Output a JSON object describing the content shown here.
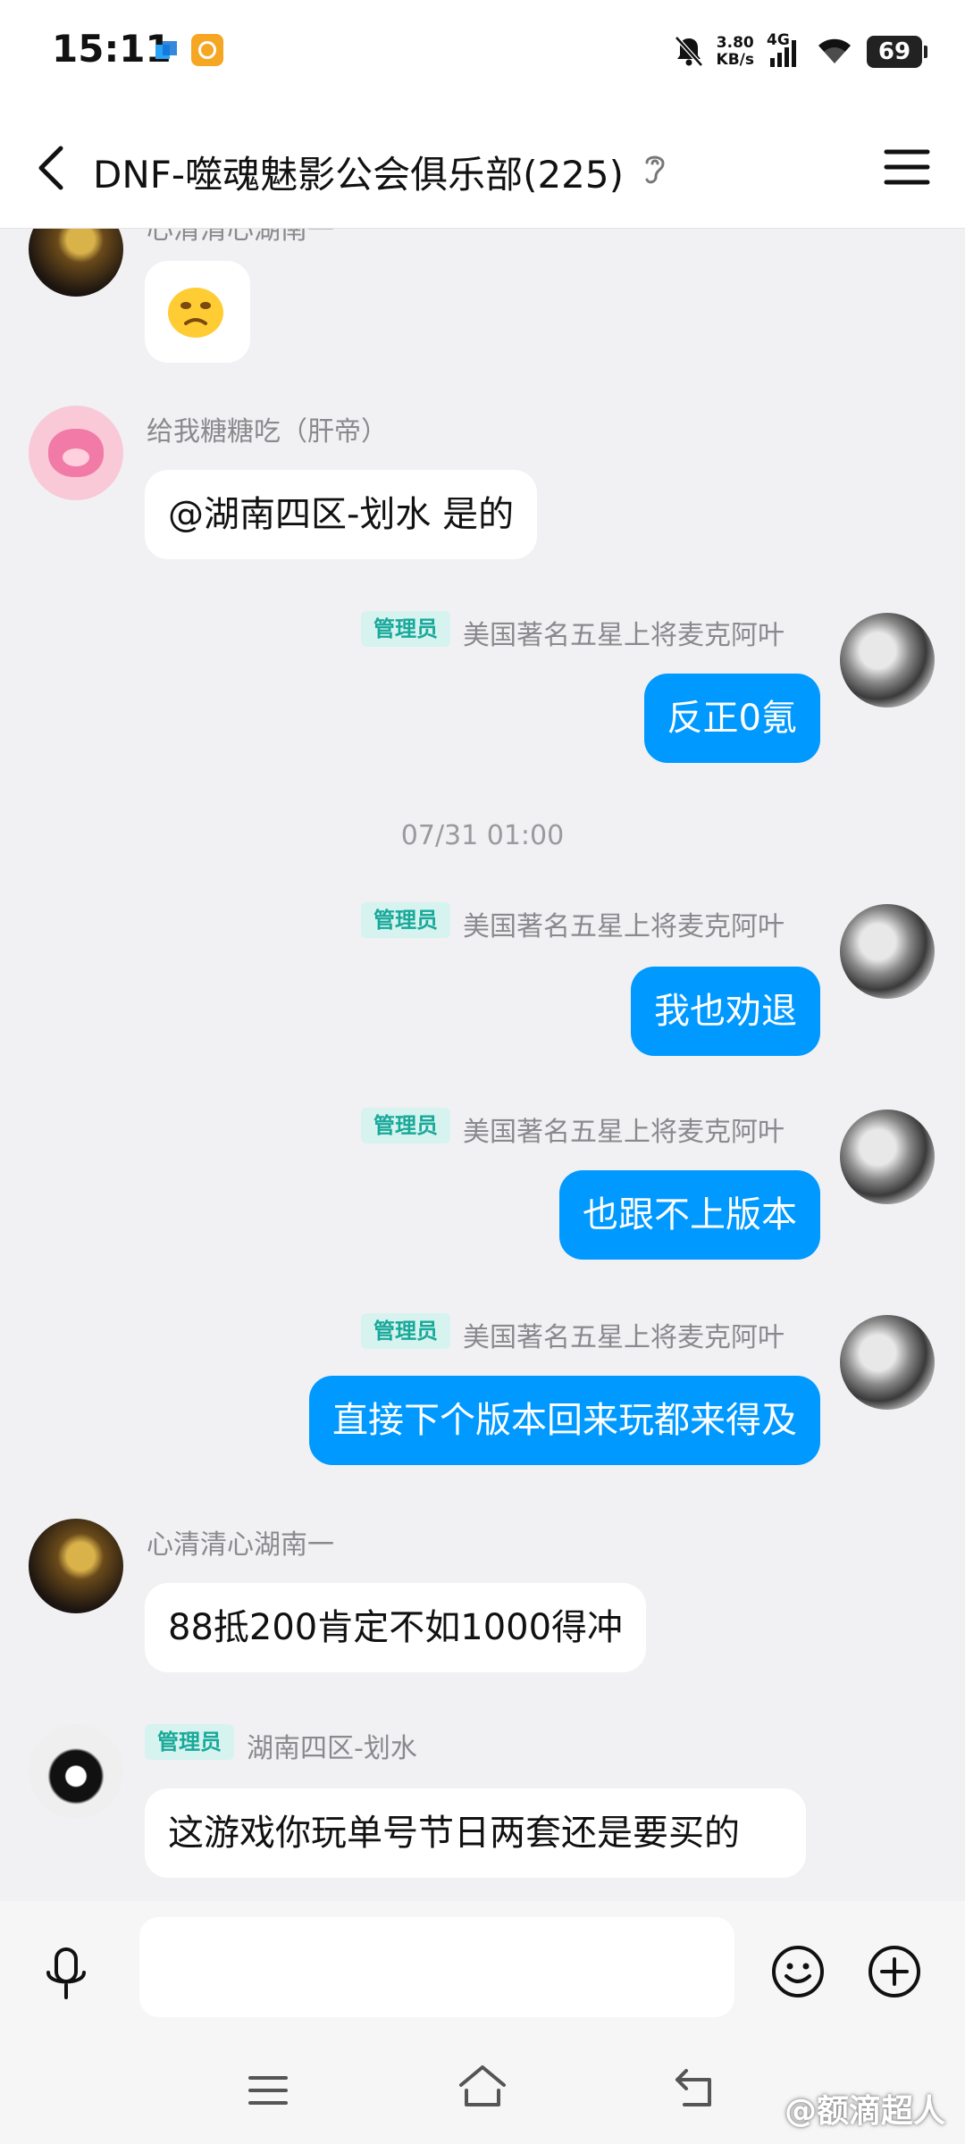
{
  "status_bar": {
    "time": "15:11",
    "net_speed_value": "3.80",
    "net_speed_unit": "KB/s",
    "signal_label": "4G",
    "battery": "69"
  },
  "header": {
    "title": "DNF-噬魂魅影公会俱乐部(225)"
  },
  "messages": [
    {
      "sender": "心清清心湖南一",
      "content": "emoji"
    },
    {
      "sender": "给我糖糖吃（肝帝）",
      "text": "@湖南四区-划水 是的"
    },
    {
      "badge": "管理员",
      "sender": "美国著名五星上将麦克阿叶",
      "text": "反正0氪"
    },
    {
      "timestamp": "07/31 01:00"
    },
    {
      "badge": "管理员",
      "sender": "美国著名五星上将麦克阿叶",
      "text": "我也劝退"
    },
    {
      "badge": "管理员",
      "sender": "美国著名五星上将麦克阿叶",
      "text": "也跟不上版本"
    },
    {
      "badge": "管理员",
      "sender": "美国著名五星上将麦克阿叶",
      "text": "直接下个版本回来玩都来得及"
    },
    {
      "sender": "心清清心湖南一",
      "text": "88抵200肯定不如1000得冲"
    },
    {
      "badge": "管理员",
      "sender": "湖南四区-划水",
      "text": "这游戏你玩单号节日两套还是要买的"
    }
  ],
  "input": {
    "value": ""
  },
  "watermark": "@额滴超人",
  "colors": {
    "outgoing_bubble": "#0099ff",
    "incoming_bubble": "#ffffff",
    "chat_background": "#f1f1f3",
    "admin_badge_bg": "#d6f3ef",
    "admin_badge_text": "#19a99a"
  }
}
